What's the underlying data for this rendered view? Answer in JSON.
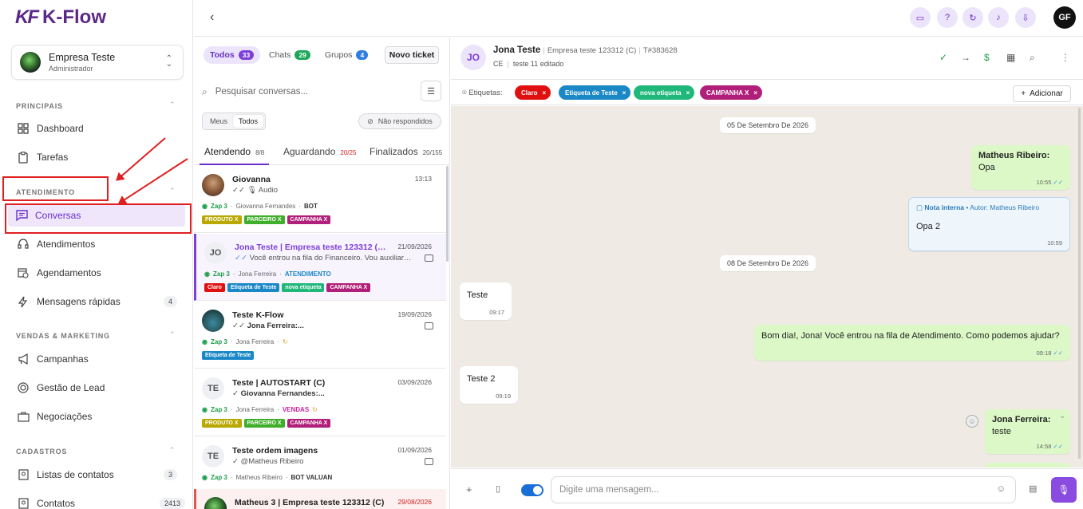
{
  "app": {
    "name": "K-Flow",
    "logo_mark": "KF"
  },
  "company": {
    "name": "Empresa Teste",
    "role": "Administrador"
  },
  "sidebar": {
    "sections": [
      {
        "label": "PRINCIPAIS",
        "items": [
          {
            "label": "Dashboard",
            "icon": "dashboard-icon"
          },
          {
            "label": "Tarefas",
            "icon": "clipboard-icon"
          }
        ]
      },
      {
        "label": "ATENDIMENTO",
        "items": [
          {
            "label": "Conversas",
            "icon": "chat-icon",
            "active": true
          },
          {
            "label": "Atendimentos",
            "icon": "headset-icon"
          },
          {
            "label": "Agendamentos",
            "icon": "calendar-clock-icon"
          },
          {
            "label": "Mensagens rápidas",
            "icon": "lightning-icon",
            "badge": "4"
          }
        ]
      },
      {
        "label": "VENDAS & MARKETING",
        "items": [
          {
            "label": "Campanhas",
            "icon": "megaphone-icon"
          },
          {
            "label": "Gestão de Lead",
            "icon": "target-icon"
          },
          {
            "label": "Negociações",
            "icon": "briefcase-icon"
          }
        ]
      },
      {
        "label": "CADASTROS",
        "items": [
          {
            "label": "Listas de contatos",
            "icon": "contact-list-icon",
            "badge": "3"
          },
          {
            "label": "Contatos",
            "icon": "contact-icon",
            "badge": "2413"
          }
        ]
      }
    ]
  },
  "colors": {
    "accent": "#6a2fc9",
    "annotation": "#e02020"
  },
  "list": {
    "filters": [
      {
        "label": "Todos",
        "count": "33",
        "color": "#7d3fd8"
      },
      {
        "label": "Chats",
        "count": "29",
        "color": "#1fa85a"
      },
      {
        "label": "Grupos",
        "count": "4",
        "color": "#2e7ee0"
      }
    ],
    "new_ticket": "Novo ticket",
    "search_placeholder": "Pesquisar conversas...",
    "segment": [
      "Meus",
      "Todos"
    ],
    "unanswered": "Não respondidos",
    "status_tabs": [
      {
        "label": "Atendendo",
        "count": "8/8"
      },
      {
        "label": "Aguardando",
        "count": "20/25"
      },
      {
        "label": "Finalizados",
        "count": "20/155"
      }
    ],
    "conversations": [
      {
        "name": "Giovanna",
        "date": "13:13",
        "preview": "Audio",
        "channel": "Zap 3",
        "agent": "Giovanna Fernandes",
        "queue": "BOT",
        "tags": [
          {
            "t": "PRODUTO X",
            "c": "#b8a800"
          },
          {
            "t": "PARCEIRO X",
            "c": "#3fae2a"
          },
          {
            "t": "CAMPANHA X",
            "c": "#b0207a"
          }
        ]
      },
      {
        "initials": "JO",
        "name": "Jona Teste | Empresa teste 123312 (C)",
        "date": "21/09/2026",
        "preview": "Você entrou na fila do Financeiro. Vou auxiliar com p...",
        "channel": "Zap 3",
        "agent": "Jona Ferreira",
        "queue": "ATENDIMENTO",
        "tags": [
          {
            "t": "Claro",
            "c": "#e01010"
          },
          {
            "t": "Etiqueta de Teste",
            "c": "#1a87c7"
          },
          {
            "t": "nova etiqueta",
            "c": "#1fb87a"
          },
          {
            "t": "CAMPANHA X",
            "c": "#b0207a"
          }
        ]
      },
      {
        "name": "Teste K-Flow",
        "date": "19/09/2026",
        "preview": "Jona Ferreira:...",
        "channel": "Zap 3",
        "agent": "Jona Ferreira",
        "queue": "",
        "tags": [
          {
            "t": "Etiqueta de Teste",
            "c": "#1a87c7"
          }
        ]
      },
      {
        "initials": "TE",
        "name": "Teste | AUTOSTART (C)",
        "date": "03/09/2026",
        "preview": "Giovanna Fernandes:...",
        "channel": "Zap 3",
        "agent": "Jona Ferreira",
        "queue": "VENDAS",
        "tags": [
          {
            "t": "PRODUTO X",
            "c": "#b8a800"
          },
          {
            "t": "PARCEIRO X",
            "c": "#3fae2a"
          },
          {
            "t": "CAMPANHA X",
            "c": "#b0207a"
          }
        ]
      },
      {
        "initials": "TE",
        "name": "Teste ordem imagens",
        "date": "01/09/2026",
        "preview": "@Matheus Ribeiro",
        "channel": "Zap 3",
        "agent": "Matheus Ribeiro",
        "queue": "BOT VALUAN",
        "tags": []
      },
      {
        "name": "Matheus 3 | Empresa teste 123312 (C)",
        "date": "29/08/2026",
        "preview": "",
        "channel": "",
        "agent": "",
        "queue": "",
        "tags": []
      }
    ]
  },
  "chat": {
    "initials": "JO",
    "name": "Jona Teste",
    "company": "Empresa teste 123312 (C)",
    "ticket": "T#383628",
    "state": "CE",
    "edited": "teste 11 editado",
    "tags_label": "Etiquetas:",
    "tags": [
      {
        "t": "Claro",
        "c": "#e01010"
      },
      {
        "t": "Etiqueta de Teste",
        "c": "#1a87c7"
      },
      {
        "t": "nova etiqueta",
        "c": "#1fb87a"
      },
      {
        "t": "CAMPANHA X",
        "c": "#b0207a"
      }
    ],
    "add_label": "Adicionar",
    "date1": "05 De Setembro De 2026",
    "date2": "08 De Setembro De 2026",
    "m1": {
      "author": "Matheus Ribeiro:",
      "text": "Opa",
      "time": "10:55"
    },
    "note": {
      "head": "Nota interna",
      "author": "• Autor: Matheus Ribeiro",
      "text": "Opa 2",
      "time": "10:59"
    },
    "m2": {
      "text": "Teste",
      "time": "09:17"
    },
    "m3": {
      "text": "Bom dia!, Jona! Você entrou na fila de Atendimento. Como podemos ajudar?",
      "time": "09:18"
    },
    "m4": {
      "text": "Teste 2",
      "time": "09:19"
    },
    "m5": {
      "author": "Jona Ferreira:",
      "text": "teste",
      "time": "14:58"
    },
    "composer_placeholder": "Digite uma mensagem..."
  },
  "user": {
    "initials": "GF"
  }
}
